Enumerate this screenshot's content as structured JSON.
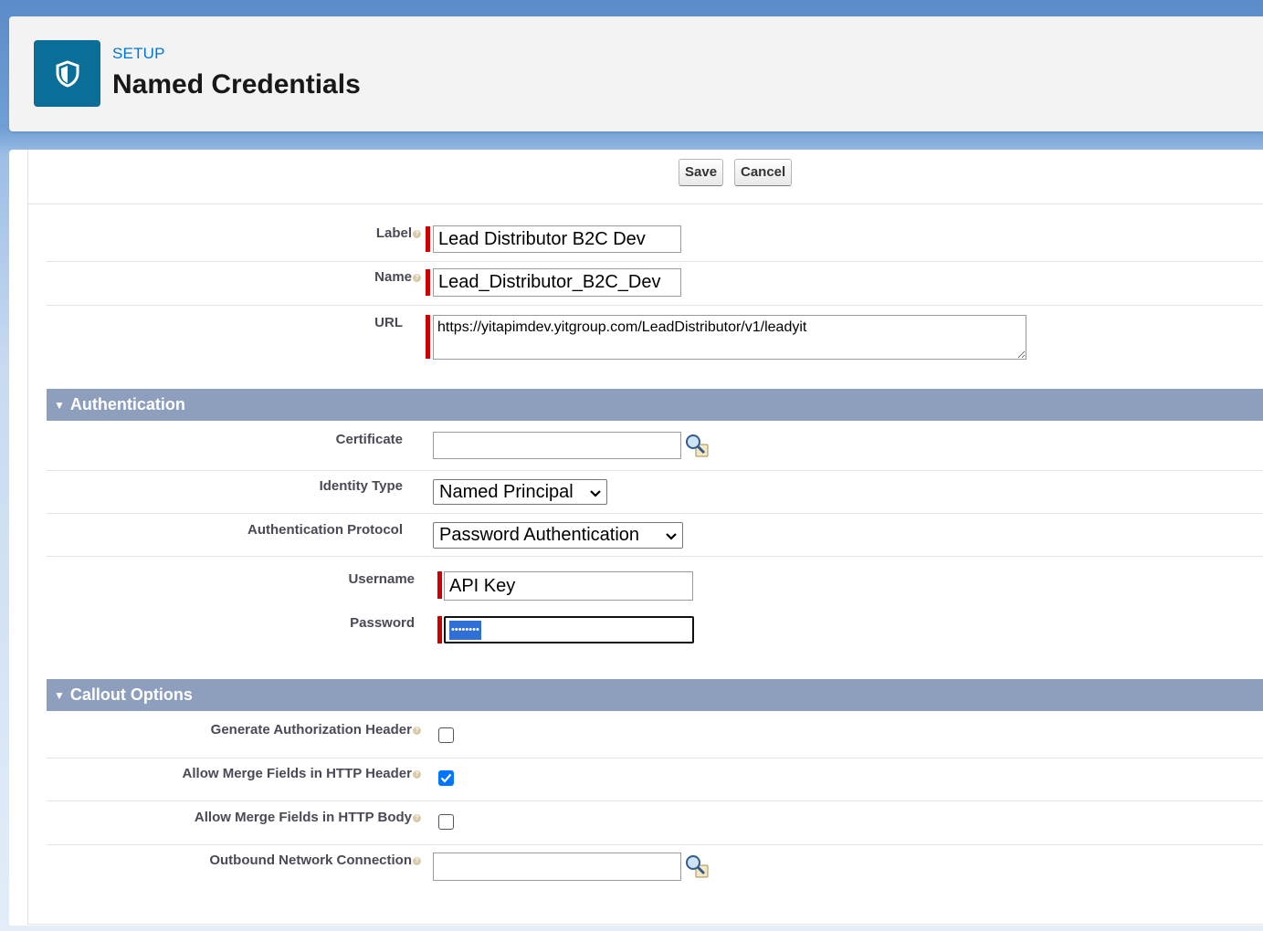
{
  "header": {
    "eyebrow": "SETUP",
    "title": "Named Credentials",
    "icon": "shield-icon"
  },
  "toolbar": {
    "save_label": "Save",
    "cancel_label": "Cancel"
  },
  "fields": {
    "label": {
      "label": "Label",
      "value": "Lead Distributor B2C Dev"
    },
    "name": {
      "label": "Name",
      "value": "Lead_Distributor_B2C_Dev"
    },
    "url": {
      "label": "URL",
      "value": "https://yitapimdev.yitgroup.com/LeadDistributor/v1/leadyit"
    }
  },
  "authentication": {
    "section_title": "Authentication",
    "certificate": {
      "label": "Certificate",
      "value": ""
    },
    "identity_type": {
      "label": "Identity Type",
      "selected": "Named Principal"
    },
    "auth_protocol": {
      "label": "Authentication Protocol",
      "selected": "Password Authentication"
    },
    "username": {
      "label": "Username",
      "value": "API Key"
    },
    "password": {
      "label": "Password",
      "masked": "••••••••"
    }
  },
  "callout": {
    "section_title": "Callout Options",
    "generate_auth_header": {
      "label": "Generate Authorization Header",
      "checked": false
    },
    "merge_http_header": {
      "label": "Allow Merge Fields in HTTP Header",
      "checked": true
    },
    "merge_http_body": {
      "label": "Allow Merge Fields in HTTP Body",
      "checked": false
    },
    "outbound_connection": {
      "label": "Outbound Network Connection",
      "value": ""
    }
  },
  "colors": {
    "brand_icon_bg": "#0b6e99",
    "eyebrow": "#0176d3",
    "section_bar": "#8e9fbd",
    "required": "#cc0000",
    "checkbox_checked": "#0075ff"
  }
}
